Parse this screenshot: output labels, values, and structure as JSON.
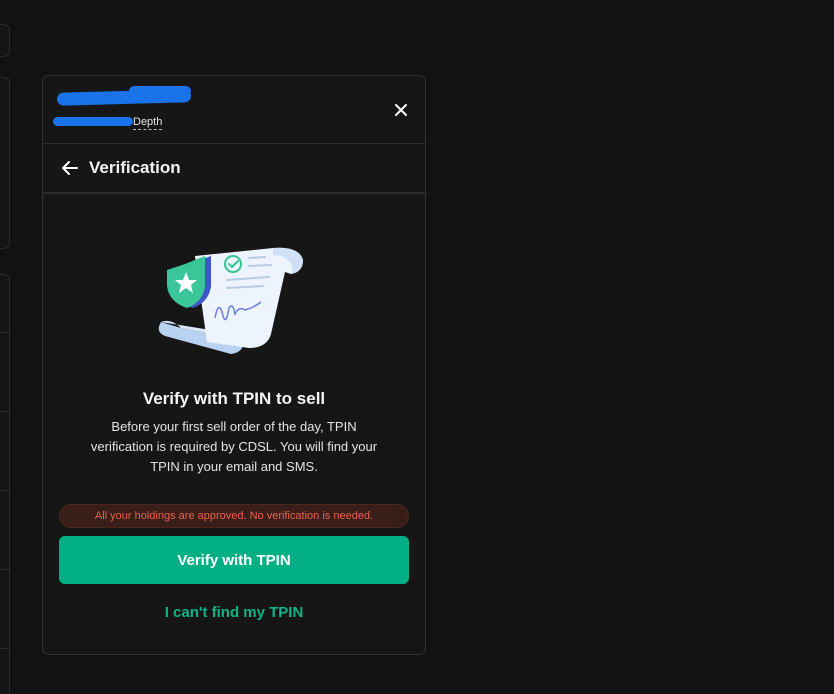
{
  "header": {
    "stock_name": "",
    "exchange_ticker": "",
    "depth_label": "Depth"
  },
  "titlebar": {
    "title": "Verification"
  },
  "content": {
    "heading": "Verify with TPIN to sell",
    "description": "Before your first sell order of the day, TPIN verification is required by CDSL. You will find your TPIN in your email and SMS.",
    "notice": "All your holdings are approved. No verification is needed.",
    "primary_button": "Verify with TPIN",
    "secondary_link": "I can't find my TPIN"
  },
  "icons": {
    "close": "close-icon",
    "back": "arrow-left-icon",
    "illustration": "shield-star-document-icon"
  },
  "colors": {
    "accent": "#03b086",
    "link": "#0fb487",
    "notice_text": "#e8634c",
    "notice_bg": "#3a1e1a",
    "panel_bg": "#161616",
    "page_bg": "#121212"
  }
}
